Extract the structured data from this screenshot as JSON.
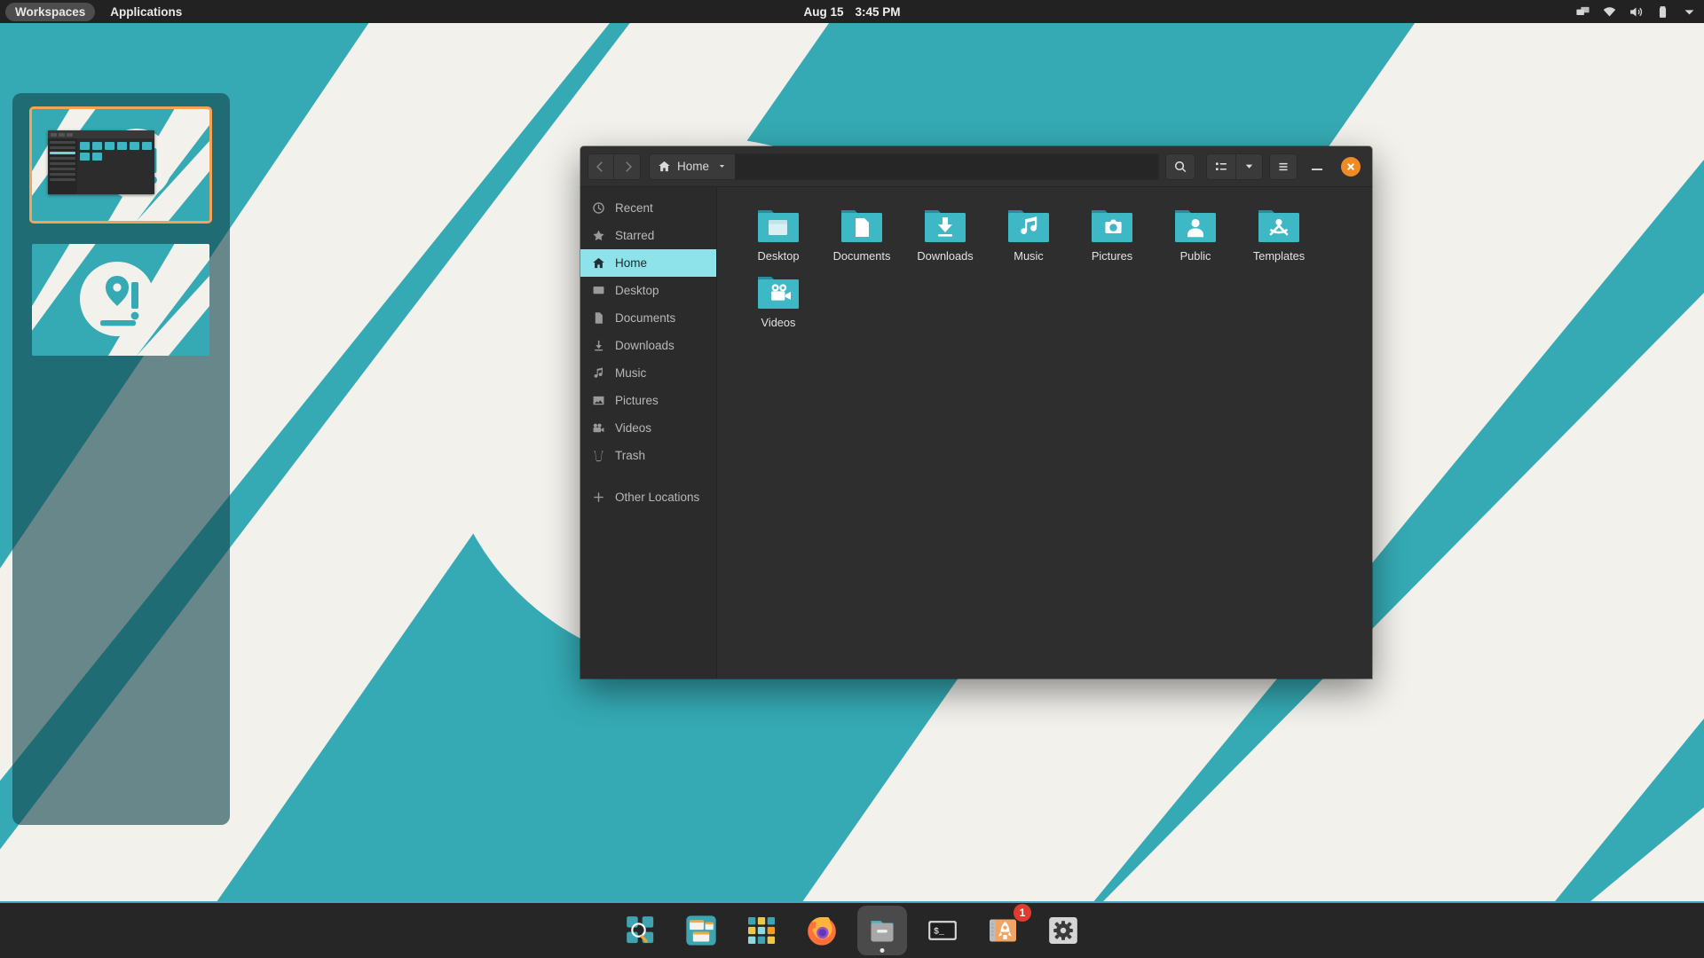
{
  "top_panel": {
    "workspaces_label": "Workspaces",
    "applications_label": "Applications",
    "clock_date": "Aug 15",
    "clock_time": "3:45 PM",
    "tray": [
      {
        "name": "display-icon",
        "label": "Displays"
      },
      {
        "name": "wifi-icon",
        "label": "Wi-Fi"
      },
      {
        "name": "volume-icon",
        "label": "Volume"
      },
      {
        "name": "battery-icon",
        "label": "Battery"
      },
      {
        "name": "chevron-down-icon",
        "label": "System Menu"
      }
    ]
  },
  "workspaces": {
    "items": [
      {
        "name": "workspace-1",
        "selected": true
      },
      {
        "name": "workspace-2",
        "selected": false
      }
    ]
  },
  "file_manager": {
    "header": {
      "back_label": "Back",
      "forward_label": "Forward",
      "path_label": "Home",
      "location_value": "",
      "location_placeholder": "",
      "search_label": "Search",
      "view_label": "View options",
      "view_dropdown_label": "View type",
      "menu_label": "Main Menu",
      "minimize_label": "Minimize",
      "close_label": "Close"
    },
    "sidebar": [
      {
        "label": "Recent",
        "icon": "clock-icon",
        "active": false
      },
      {
        "label": "Starred",
        "icon": "star-icon",
        "active": false
      },
      {
        "label": "Home",
        "icon": "home-icon",
        "active": true
      },
      {
        "label": "Desktop",
        "icon": "desktop-icon",
        "active": false
      },
      {
        "label": "Documents",
        "icon": "document-icon",
        "active": false
      },
      {
        "label": "Downloads",
        "icon": "download-icon",
        "active": false
      },
      {
        "label": "Music",
        "icon": "music-icon",
        "active": false
      },
      {
        "label": "Pictures",
        "icon": "picture-icon",
        "active": false
      },
      {
        "label": "Videos",
        "icon": "video-icon",
        "active": false
      },
      {
        "label": "Trash",
        "icon": "trash-icon",
        "active": false
      },
      {
        "label": "Other Locations",
        "icon": "plus-icon",
        "active": false
      }
    ],
    "files": [
      {
        "label": "Desktop",
        "icon": "folder-desktop-icon"
      },
      {
        "label": "Documents",
        "icon": "folder-documents-icon"
      },
      {
        "label": "Downloads",
        "icon": "folder-downloads-icon"
      },
      {
        "label": "Music",
        "icon": "folder-music-icon"
      },
      {
        "label": "Pictures",
        "icon": "folder-pictures-icon"
      },
      {
        "label": "Public",
        "icon": "folder-public-icon"
      },
      {
        "label": "Templates",
        "icon": "folder-templates-icon"
      },
      {
        "label": "Videos",
        "icon": "folder-videos-icon"
      }
    ]
  },
  "dock": {
    "items": [
      {
        "name": "workspace-search-icon",
        "label": "Workspaces Search",
        "active": false,
        "badge": ""
      },
      {
        "name": "tiling-icon",
        "label": "Window Tiling",
        "active": false,
        "badge": ""
      },
      {
        "name": "app-grid-icon",
        "label": "Applications",
        "active": false,
        "badge": ""
      },
      {
        "name": "firefox-icon",
        "label": "Firefox",
        "active": false,
        "badge": ""
      },
      {
        "name": "files-icon",
        "label": "Files",
        "active": true,
        "badge": ""
      },
      {
        "name": "terminal-icon",
        "label": "Terminal",
        "active": false,
        "badge": ""
      },
      {
        "name": "pop-shop-icon",
        "label": "Pop!_Shop",
        "active": false,
        "badge": "1"
      },
      {
        "name": "settings-icon",
        "label": "Settings",
        "active": false,
        "badge": ""
      }
    ]
  },
  "colors": {
    "desktop_teal": "#35aab4",
    "panel_dark": "#222222",
    "window_bg": "#2e2e2e",
    "sidebar_highlight": "#8ee3ea",
    "close_orange": "#f08a24",
    "badge_red": "#e03b2f",
    "folder_teal": "#3fb8c6",
    "workspace_selected_border": "#f5a356"
  }
}
